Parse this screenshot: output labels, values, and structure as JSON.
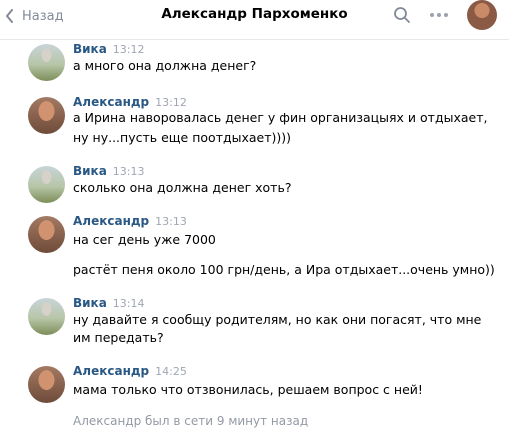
{
  "header": {
    "back_label": "Назад",
    "title": "Александр Пархоменко"
  },
  "messages": [
    {
      "author": "Вика",
      "time": "13:12",
      "lines": [
        "а много она должна денег?"
      ]
    },
    {
      "author": "Александр",
      "time": "13:12",
      "lines": [
        "а Ирина наворовалась денег у фин организацыях и отдыхает,",
        "ну ну...пусть еще поотдыхает))))"
      ]
    },
    {
      "author": "Вика",
      "time": "13:13",
      "lines": [
        "сколько она должна денег хоть?"
      ]
    },
    {
      "author": "Александр",
      "time": "13:13",
      "lines": [
        "на сег день уже 7000",
        "растёт пеня около 100 грн/день, а Ира отдыхает...очень умно))"
      ]
    },
    {
      "author": "Вика",
      "time": "13:14",
      "lines": [
        "ну давайте я сообщу родителям, но как они погасят, что мне",
        "им передать?"
      ]
    },
    {
      "author": "Александр",
      "time": "14:25",
      "lines": [
        "мама только что отзвонилась, решаем вопрос с ней!"
      ]
    }
  ],
  "status": "Александр был в сети 9 минут назад",
  "colors": {
    "name": "#2a5885",
    "time": "#a0a6b2",
    "muted": "#828a99"
  }
}
